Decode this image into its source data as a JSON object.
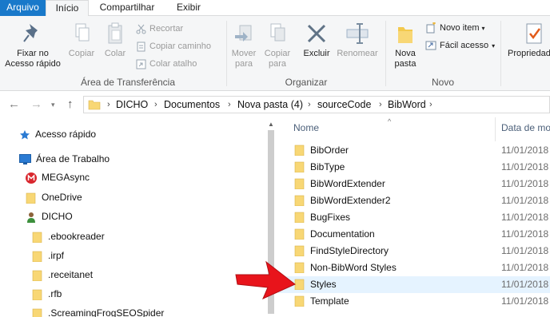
{
  "tabs": {
    "file": "Arquivo",
    "home": "Início",
    "share": "Compartilhar",
    "view": "Exibir"
  },
  "ribbon": {
    "clipboard": {
      "pin_label_1": "Fixar no",
      "pin_label_2": "Acesso rápido",
      "copy": "Copiar",
      "paste": "Colar",
      "cut": "Recortar",
      "copy_path": "Copiar caminho",
      "paste_shortcut": "Colar atalho",
      "group_label": "Área de Transferência"
    },
    "organize": {
      "move_1": "Mover",
      "move_2": "para",
      "copy_1": "Copiar",
      "copy_2": "para",
      "delete": "Excluir",
      "rename": "Renomear",
      "group_label": "Organizar"
    },
    "new": {
      "new_folder_1": "Nova",
      "new_folder_2": "pasta",
      "new_item": "Novo item",
      "easy_access": "Fácil acesso",
      "group_label": "Novo"
    },
    "open": {
      "properties": "Propriedades"
    }
  },
  "address": {
    "crumbs": [
      "DICHO",
      "Documentos",
      "Nova pasta (4)",
      "sourceCode",
      "BibWord"
    ]
  },
  "nav": {
    "quick_access": "Acesso rápido",
    "desktop": "Área de Trabalho",
    "megasync": "MEGAsync",
    "onedrive": "OneDrive",
    "user": "DICHO",
    "folders": [
      ".ebookreader",
      ".irpf",
      ".receitanet",
      ".rfb",
      ".ScreamingFrogSEOSpider"
    ]
  },
  "files": {
    "col_name": "Nome",
    "col_date": "Data de mo",
    "rows": [
      {
        "name": "BibOrder",
        "date": "11/01/2018"
      },
      {
        "name": "BibType",
        "date": "11/01/2018"
      },
      {
        "name": "BibWordExtender",
        "date": "11/01/2018"
      },
      {
        "name": "BibWordExtender2",
        "date": "11/01/2018"
      },
      {
        "name": "BugFixes",
        "date": "11/01/2018"
      },
      {
        "name": "Documentation",
        "date": "11/01/2018"
      },
      {
        "name": "FindStyleDirectory",
        "date": "11/01/2018"
      },
      {
        "name": "Non-BibWord Styles",
        "date": "11/01/2018"
      },
      {
        "name": "Styles",
        "date": "11/01/2018"
      },
      {
        "name": "Template",
        "date": "11/01/2018"
      }
    ]
  },
  "colors": {
    "file_tab": "#1979ca",
    "folder": "#f8d775",
    "highlight": "#e5f3ff",
    "arrow": "#e8141b"
  }
}
